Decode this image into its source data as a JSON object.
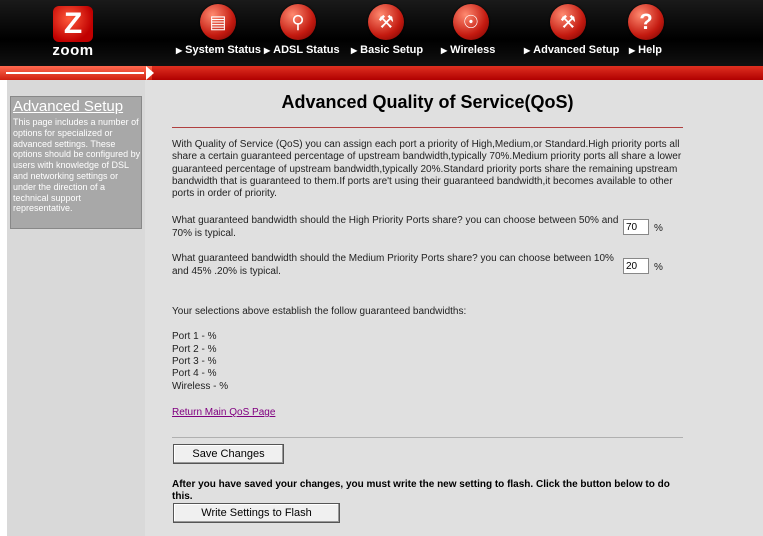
{
  "logo": {
    "badge": "Z",
    "text": "zoom"
  },
  "nav": [
    {
      "label": "System Status",
      "icon": "document-icon"
    },
    {
      "label": "ADSL Status",
      "icon": "magnifier-icon"
    },
    {
      "label": "Basic Setup",
      "icon": "wrench-icon"
    },
    {
      "label": "Wireless",
      "icon": "antenna-icon"
    },
    {
      "label": "Advanced Setup",
      "icon": "tools-icon"
    },
    {
      "label": "Help",
      "icon": "question-icon"
    }
  ],
  "sidebar": {
    "title": "Advanced Setup",
    "description": "This page includes a number of options for specialized or advanced settings. These options should be configured by users with knowledge of DSL and networking settings or under the direction of a technical support representative."
  },
  "main": {
    "title": "Advanced Quality of Service(QoS)",
    "intro": "With Quality of Service (QoS) you can assign each port a priority of High,Medium,or Standard.High priority ports all share a certain guaranteed percentage of upstream bandwidth,typically 70%.Medium priority ports all share a lower guaranteed percentage of upstream bandwidth,typically 20%.Standard priority ports share the remaining upstream bandwidth that is guaranteed to them.If ports are't using their guaranteed bandwidth,it becomes available to other ports in order of priority.",
    "high_question": "What guaranteed bandwidth should the High Priority Ports share? you can choose between 50% and 70% is typical.",
    "high_value": "70",
    "medium_question": "What guaranteed bandwidth should the Medium Priority Ports share? you can choose between 10% and 45% .20% is typical.",
    "medium_value": "20",
    "percent": "%",
    "selections_text": "Your selections above establish the follow guaranteed bandwidths:",
    "ports": [
      "Port 1 - %",
      "Port 2 - %",
      "Port 3 - %",
      "Port 4 - %",
      "Wireless - %"
    ],
    "return_link": "Return Main QoS Page",
    "save_button": "Save Changes",
    "flash_note": "After you have saved your changes, you must write the new setting to flash. Click the button below to do this.",
    "flash_button": "Write Settings to Flash"
  },
  "colors": {
    "accent_red": "#c41a10",
    "panel_gray": "#a8a8a8",
    "main_bg": "#e0e0e0",
    "link": "#800080"
  }
}
